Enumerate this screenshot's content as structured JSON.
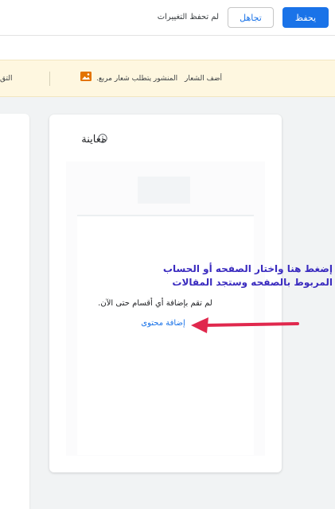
{
  "topbar": {
    "save_label": "يحفظ",
    "ignore_label": "تجاهل",
    "unsaved_text": "لم تحفظ التغييرات"
  },
  "banner": {
    "title": "أضف الشعار",
    "message": ".المنشور يتطلب شعار مربع",
    "cut_text": "التق",
    "icon": "image-icon",
    "icon_color": "#e37400"
  },
  "preview": {
    "title": "معاينة",
    "info_icon": "info-icon",
    "empty_text": ".لم تقم بإضافة أي أقسام حتى الآن",
    "add_content_label": "إضافة محتوى"
  },
  "annotation": {
    "line1": "إضغط هنا  واختار الصفحه أو الحساب",
    "line2": "المربوط بالصفحه وستجد المقالات",
    "color": "#3a2bbf",
    "arrow_color": "#e0284d"
  },
  "colors": {
    "accent": "#1a73e8",
    "banner_bg": "#fef7e0"
  }
}
